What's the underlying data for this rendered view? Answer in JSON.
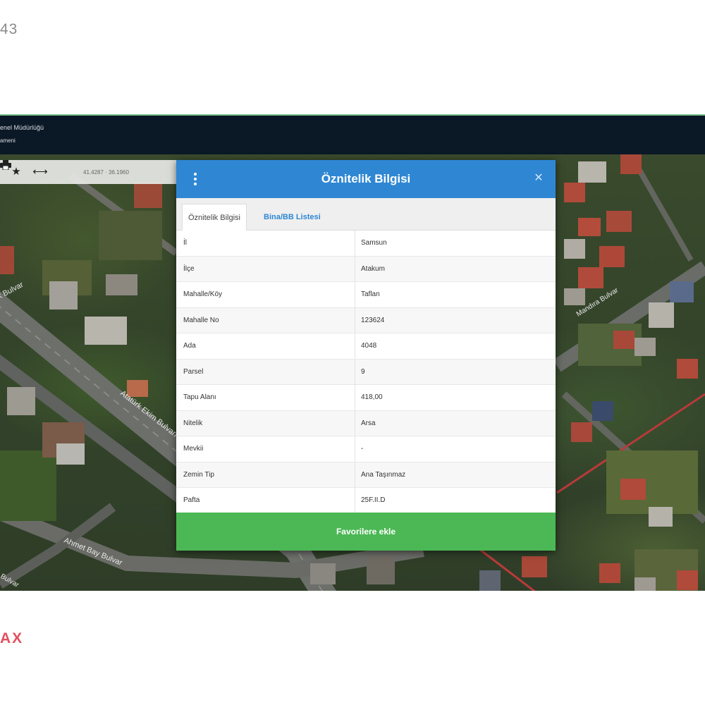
{
  "page": {
    "top_number": "43",
    "bottom_brand": "AX"
  },
  "app": {
    "header": {
      "title_line1": "enel Müdürlüğü",
      "title_line2": "ameni"
    },
    "toolbar": {
      "icons": [
        "star-icon",
        "minus-icon",
        "print-icon"
      ],
      "coords": "41.4287 · 36.1960"
    },
    "map": {
      "road_labels": [
        "ürk Bulvar",
        "Atatürk Ekim Bulvarı",
        "Ahmet Bay Bulvar",
        "Bulvar",
        "Mandıra Bulvar"
      ]
    }
  },
  "modal": {
    "title": "Öznitelik Bilgisi",
    "close_glyph": "✕",
    "tabs": [
      {
        "label": "Öznitelik Bilgisi",
        "active": true
      },
      {
        "label": "Bina/BB Listesi",
        "active": false
      }
    ],
    "rows": [
      {
        "key": "İl",
        "value": "Samsun"
      },
      {
        "key": "İlçe",
        "value": "Atakum"
      },
      {
        "key": "Mahalle/Köy",
        "value": "Taflan"
      },
      {
        "key": "Mahalle No",
        "value": "123624"
      },
      {
        "key": "Ada",
        "value": "4048"
      },
      {
        "key": "Parsel",
        "value": "9"
      },
      {
        "key": "Tapu Alanı",
        "value": "418,00"
      },
      {
        "key": "Nitelik",
        "value": "Arsa"
      },
      {
        "key": "Mevkii",
        "value": "-"
      },
      {
        "key": "Zemin Tip",
        "value": "Ana Taşınmaz"
      },
      {
        "key": "Pafta",
        "value": "25F.II.D"
      }
    ],
    "favorite_button": "Favorilere ekle"
  },
  "colors": {
    "header_blue": "#2f87d3",
    "button_green": "#4cb855",
    "app_header": "#0b1826",
    "brand_red": "#e2505f"
  }
}
